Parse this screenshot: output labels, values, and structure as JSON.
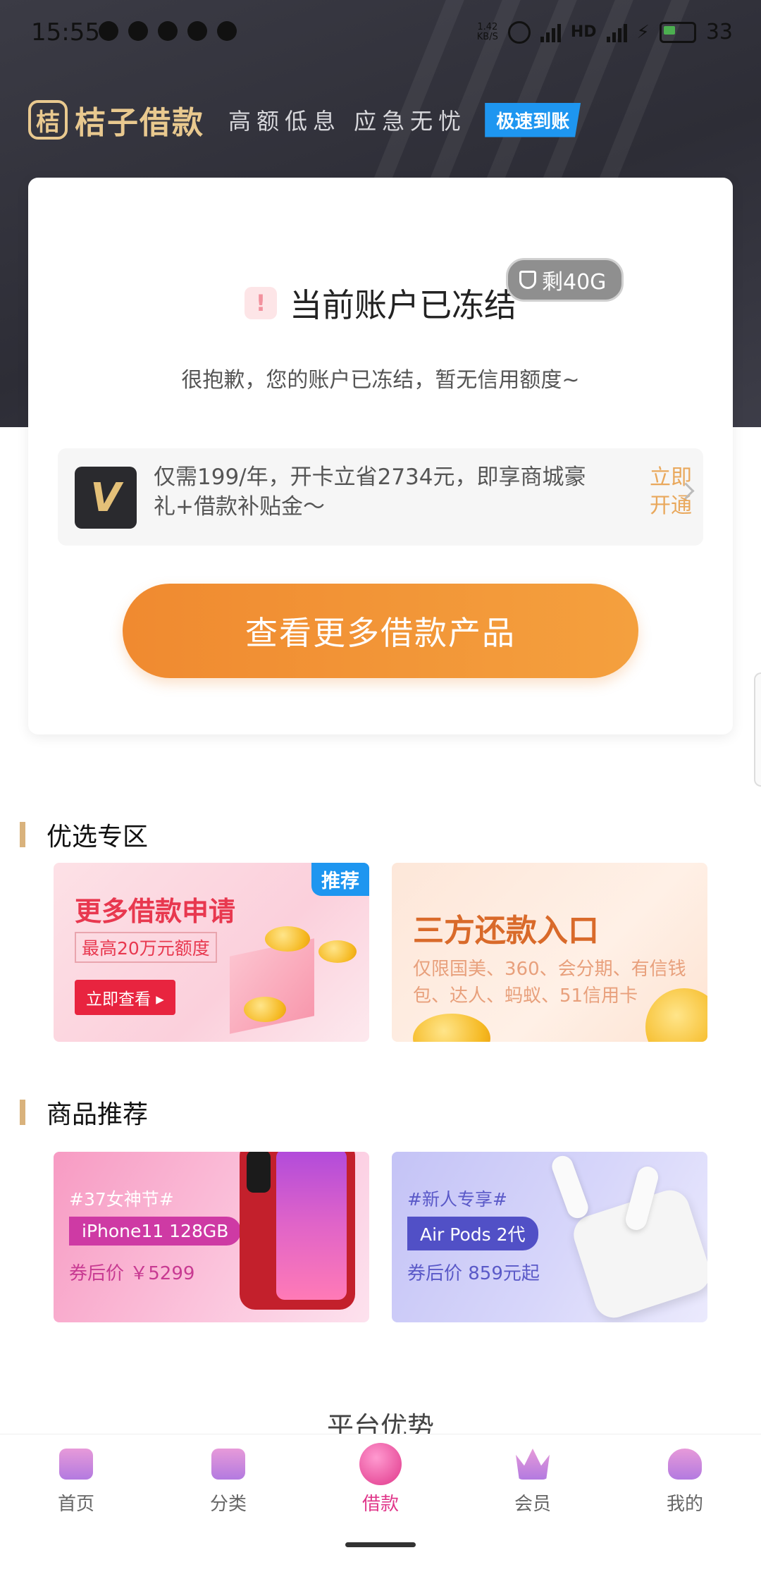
{
  "status_bar": {
    "time": "15:55",
    "net_speed_top": "1.42",
    "net_speed_bottom": "KB/S",
    "network_label": "HD",
    "battery": "33"
  },
  "brand": {
    "logo_char": "桔",
    "name": "桔子借款",
    "slogan": "高额低息 应急无忧",
    "badge": "极速到账"
  },
  "account_card": {
    "title": "当前账户已冻结",
    "data_pill": "剩40G",
    "description": "很抱歉，您的账户已冻结，暂无信用额度~",
    "vip": {
      "logo_letter": "V",
      "text": "仅需199/年，开卡立省2734元，即享商城豪礼+借款补贴金～",
      "action": "立即开通"
    },
    "more_button": "查看更多借款产品"
  },
  "featured": {
    "title": "优选专区",
    "cards": [
      {
        "title": "更多借款申请",
        "subtitle": "最高20万元额度",
        "cta": "立即查看 ▸",
        "badge": "推荐"
      },
      {
        "title": "三方还款入口",
        "description": "仅限国美、360、会分期、有信钱包、达人、蚂蚁、51信用卡"
      }
    ]
  },
  "products": {
    "title": "商品推荐",
    "items": [
      {
        "tag": "#37女神节#",
        "name": "iPhone11 128GB",
        "price": "券后价 ￥5299"
      },
      {
        "tag": "#新人专享#",
        "name": "Air Pods 2代",
        "price": "券后价 859元起"
      }
    ]
  },
  "platform_peek": "平台优势",
  "tabbar": {
    "items": [
      {
        "label": "首页",
        "icon": "home-icon",
        "color": "#c978d8"
      },
      {
        "label": "分类",
        "icon": "category-icon",
        "color": "#c978d8"
      },
      {
        "label": "借款",
        "icon": "loan-icon",
        "color": "#e0378a"
      },
      {
        "label": "会员",
        "icon": "vip-crown-icon",
        "color": "#c978d8"
      },
      {
        "label": "我的",
        "icon": "profile-icon",
        "color": "#c978d8"
      }
    ],
    "active_index": 2
  },
  "colors": {
    "brand_gold": "#e9c98f",
    "accent_orange": "#f08a30",
    "badge_blue": "#1e96f0",
    "active_tab": "#e0378a"
  }
}
